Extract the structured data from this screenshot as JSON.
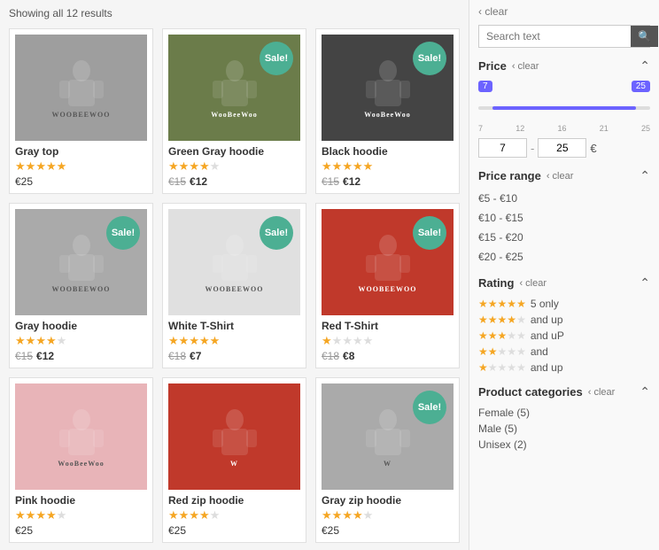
{
  "results": {
    "count_label": "Showing all 12 results"
  },
  "products": [
    {
      "name": "Gray top",
      "rating": 5,
      "max_rating": 5,
      "price_regular": "€25",
      "price_old": null,
      "price_new": null,
      "sale": false,
      "img_class": "img-gray-top",
      "brand": "WOOBEEWOO"
    },
    {
      "name": "Green Gray hoodie",
      "rating": 3.5,
      "max_rating": 5,
      "price_regular": null,
      "price_old": "€15",
      "price_new": "€12",
      "sale": true,
      "img_class": "img-green-hoodie",
      "brand": "WooBeeWoo"
    },
    {
      "name": "Black hoodie",
      "rating": 5,
      "max_rating": 5,
      "price_regular": null,
      "price_old": "€15",
      "price_new": "€12",
      "sale": true,
      "img_class": "img-black-hoodie",
      "brand": "WooBeeWoo"
    },
    {
      "name": "Gray hoodie",
      "rating": 3.5,
      "max_rating": 5,
      "price_regular": null,
      "price_old": "€15",
      "price_new": "€12",
      "sale": true,
      "img_class": "img-gray-hoodie",
      "brand": "WOOBEEWOO"
    },
    {
      "name": "White T-Shirt",
      "rating": 5,
      "max_rating": 5,
      "price_regular": null,
      "price_old": "€18",
      "price_new": "€7",
      "sale": true,
      "img_class": "img-white-tshirt",
      "brand": "WOOBEEWOO"
    },
    {
      "name": "Red T-Shirt",
      "rating": 1,
      "max_rating": 5,
      "price_regular": null,
      "price_old": "€18",
      "price_new": "€8",
      "sale": true,
      "img_class": "img-red-tshirt",
      "brand": "WOOBEEWOO"
    },
    {
      "name": "Pink hoodie",
      "rating": 4,
      "max_rating": 5,
      "price_regular": "€25",
      "price_old": null,
      "price_new": null,
      "sale": false,
      "img_class": "img-pink-hoodie",
      "brand": "WooBeeWoo"
    },
    {
      "name": "Red zip hoodie",
      "rating": 4,
      "max_rating": 5,
      "price_regular": "€25",
      "price_old": null,
      "price_new": null,
      "sale": false,
      "img_class": "img-red-zip",
      "brand": "W"
    },
    {
      "name": "Gray zip hoodie",
      "rating": 4,
      "max_rating": 5,
      "price_regular": "€25",
      "price_old": null,
      "price_new": null,
      "sale": true,
      "img_class": "img-gray-zip",
      "brand": "W"
    }
  ],
  "sidebar": {
    "clear_top": "‹ clear",
    "search": {
      "placeholder": "Search text",
      "value": ""
    },
    "price": {
      "title": "Price",
      "clear": "‹ clear",
      "min": 7,
      "max": 25,
      "slider_min": 7,
      "slider_max": 25,
      "tick_labels": [
        "7",
        "12",
        "16",
        "21",
        "25"
      ],
      "currency": "€"
    },
    "price_range": {
      "title": "Price range",
      "clear": "‹ clear",
      "items": [
        "€5 - €10",
        "€10 - €15",
        "€15 - €20",
        "€20 - €25"
      ]
    },
    "rating": {
      "title": "Rating",
      "clear": "‹ clear",
      "items": [
        {
          "stars": 5,
          "label": "5 only"
        },
        {
          "stars": 4,
          "label": "and up"
        },
        {
          "stars": 3,
          "label": "and uP"
        },
        {
          "stars": 2,
          "label": "and"
        },
        {
          "stars": 1,
          "label": "and up"
        }
      ]
    },
    "categories": {
      "title": "Product categories",
      "clear": "‹ clear",
      "items": [
        {
          "name": "Female",
          "count": 5
        },
        {
          "name": "Male",
          "count": 5
        },
        {
          "name": "Unisex",
          "count": 2
        }
      ]
    }
  }
}
